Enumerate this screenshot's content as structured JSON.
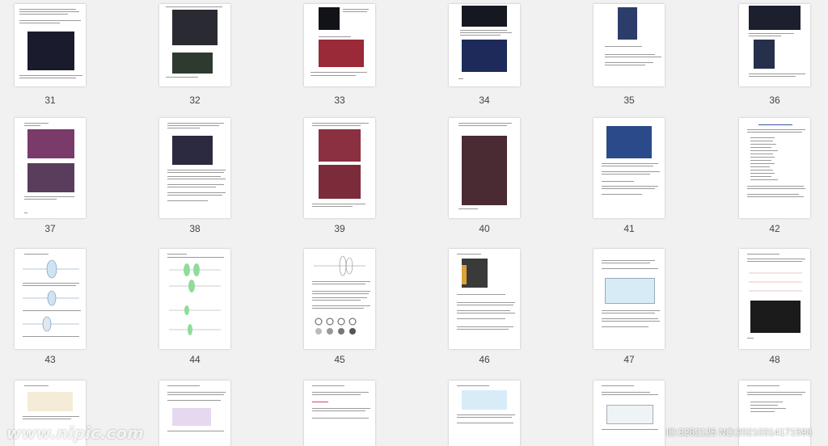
{
  "pages": [
    {
      "n": "31"
    },
    {
      "n": "32"
    },
    {
      "n": "33"
    },
    {
      "n": "34"
    },
    {
      "n": "35"
    },
    {
      "n": "36"
    },
    {
      "n": "37"
    },
    {
      "n": "38"
    },
    {
      "n": "39"
    },
    {
      "n": "40"
    },
    {
      "n": "41"
    },
    {
      "n": "42"
    },
    {
      "n": "43"
    },
    {
      "n": "44"
    },
    {
      "n": "45"
    },
    {
      "n": "46"
    },
    {
      "n": "47"
    },
    {
      "n": "48"
    },
    {
      "n": ""
    },
    {
      "n": ""
    },
    {
      "n": ""
    },
    {
      "n": ""
    },
    {
      "n": ""
    },
    {
      "n": ""
    }
  ],
  "watermark": {
    "left": "www.nipic.com",
    "right": "ID:3282125 NO:20210314171598"
  }
}
